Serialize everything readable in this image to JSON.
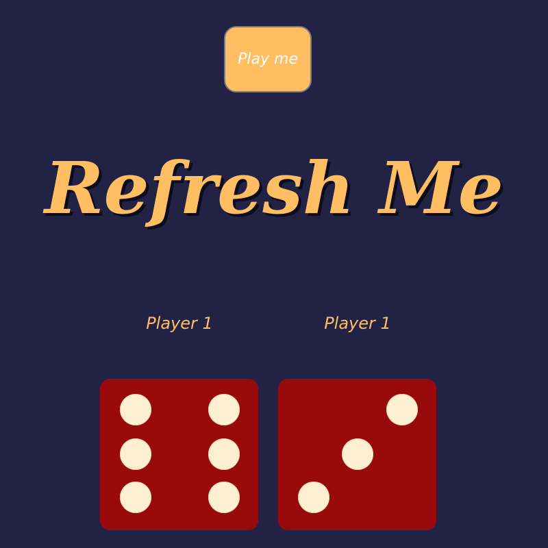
{
  "play_button": {
    "label": "Play me"
  },
  "title": "Refresh Me",
  "players": [
    {
      "label": "Player 1",
      "die_value": 6
    },
    {
      "label": "Player 1",
      "die_value": 3
    }
  ],
  "colors": {
    "background": "#222244",
    "accent": "#FFBE62",
    "die": "#990A0E",
    "pip": "#FDF0D0"
  }
}
